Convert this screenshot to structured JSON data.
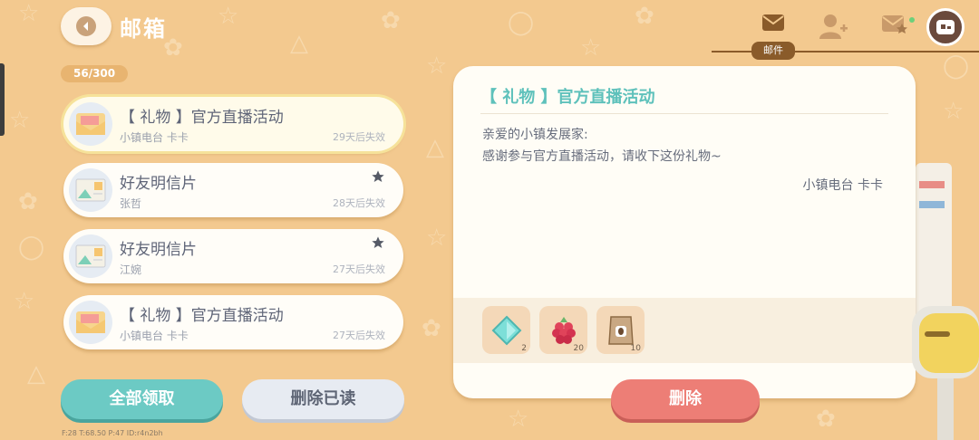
{
  "header": {
    "title": "邮箱",
    "mail_count": "56/300",
    "tabs": [
      {
        "name": "mail",
        "label": "邮件",
        "active": true
      },
      {
        "name": "friend-add",
        "active": false
      },
      {
        "name": "star-mail",
        "active": false
      }
    ]
  },
  "mail_list": [
    {
      "title": "【 礼物 】官方直播活动",
      "sender": "小镇电台 卡卡",
      "expire": "29天后失效",
      "type": "gift",
      "starred": false,
      "selected": true
    },
    {
      "title": "好友明信片",
      "sender": "张哲",
      "expire": "28天后失效",
      "type": "postcard",
      "starred": true,
      "selected": false
    },
    {
      "title": "好友明信片",
      "sender": "江婉",
      "expire": "27天后失效",
      "type": "postcard",
      "starred": true,
      "selected": false
    },
    {
      "title": "【 礼物 】官方直播活动",
      "sender": "小镇电台 卡卡",
      "expire": "27天后失效",
      "type": "gift",
      "starred": false,
      "selected": false
    }
  ],
  "buttons": {
    "claim_all": "全部领取",
    "delete_read": "删除已读",
    "delete": "删除"
  },
  "detail": {
    "title": "【 礼物 】官方直播活动",
    "greeting": "亲爱的小镇发展家:",
    "body": "感谢参与官方直播活动，请收下这份礼物~",
    "signature": "小镇电台 卡卡",
    "attachments": [
      {
        "icon": "diamond-icon",
        "count": "2"
      },
      {
        "icon": "raspberry-icon",
        "count": "20"
      },
      {
        "icon": "coffee-bag-icon",
        "count": "10"
      }
    ]
  },
  "debug": "F:28  T:68.50  P:47  ID:r4n2bh",
  "colors": {
    "background": "#f3c98f",
    "accent_teal": "#6ccac4",
    "delete_red": "#ed7e76",
    "title_teal": "#5ec1bb"
  }
}
